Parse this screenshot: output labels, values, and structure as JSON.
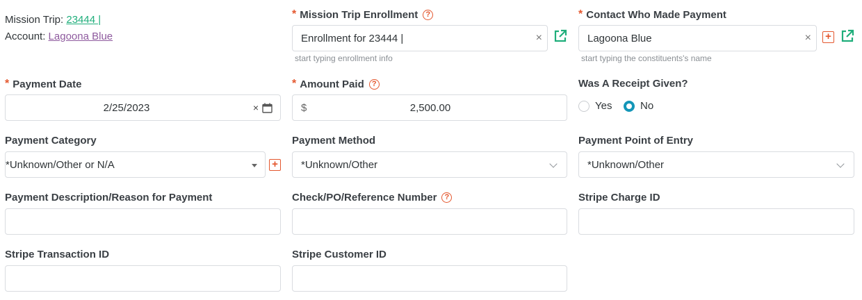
{
  "meta": {
    "mission_trip_label": "Mission Trip:",
    "mission_trip_value": "23444 |",
    "account_label": "Account:",
    "account_value": "Lagoona Blue",
    "mission_trip_color": "#1fae7b",
    "account_color": "#8e5a9e"
  },
  "enrollment": {
    "label": "Mission Trip Enrollment",
    "value": "Enrollment for 23444 |",
    "hint": "start typing enrollment info",
    "clear": "×"
  },
  "contact": {
    "label": "Contact Who Made Payment",
    "value": "Lagoona Blue",
    "hint": "start typing the constituents's name",
    "clear": "×"
  },
  "payment_date": {
    "label": "Payment Date",
    "value": "2/25/2023",
    "clear": "×"
  },
  "amount_paid": {
    "label": "Amount Paid",
    "currency": "$",
    "value": "2,500.00"
  },
  "receipt": {
    "label": "Was A Receipt Given?",
    "options": [
      "Yes",
      "No"
    ],
    "selected": "No"
  },
  "payment_category": {
    "label": "Payment Category",
    "value": "*Unknown/Other or N/A"
  },
  "payment_method": {
    "label": "Payment Method",
    "value": "*Unknown/Other"
  },
  "point_of_entry": {
    "label": "Payment Point of Entry",
    "value": "*Unknown/Other"
  },
  "description": {
    "label": "Payment Description/Reason for Payment",
    "value": ""
  },
  "reference": {
    "label": "Check/PO/Reference Number",
    "value": ""
  },
  "stripe_charge": {
    "label": "Stripe Charge ID",
    "value": ""
  },
  "stripe_transaction": {
    "label": "Stripe Transaction ID",
    "value": ""
  },
  "stripe_customer": {
    "label": "Stripe Customer ID",
    "value": ""
  },
  "colors": {
    "required": "#e4572e",
    "accent": "#1496b8",
    "external_link": "#1fae7b"
  },
  "icons": {
    "help": "question-circle-icon",
    "add": "plus-square-icon",
    "external": "external-link-icon",
    "calendar": "calendar-icon",
    "chevron": "chevron-down-icon"
  }
}
